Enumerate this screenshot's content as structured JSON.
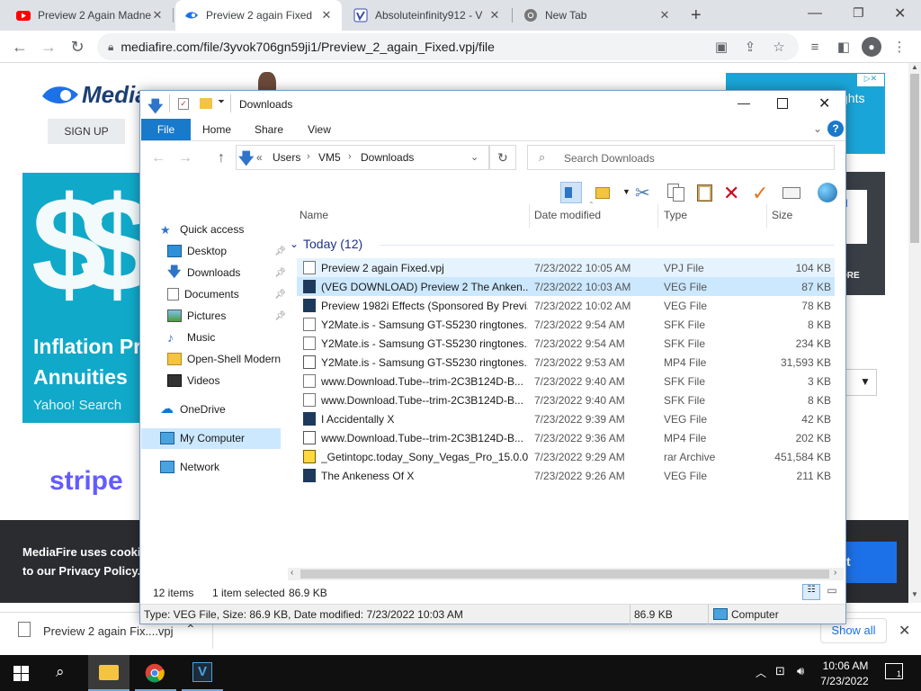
{
  "browser": {
    "tabs": [
      {
        "title": "Preview 2 Again Madne",
        "icon": "youtube-icon",
        "active": false
      },
      {
        "title": "Preview 2 again Fixed",
        "icon": "mediafire-icon",
        "active": true
      },
      {
        "title": "Absoluteinfinity912 - V",
        "icon": "vimeo-icon",
        "active": false
      },
      {
        "title": "New Tab",
        "icon": "chrome-icon",
        "active": false
      }
    ],
    "url": "mediafire.com/file/3yvok706gn59ji1/Preview_2_again_Fixed.vpj/file"
  },
  "webpage": {
    "logo": "MediaFire",
    "signup": "SIGN UP",
    "ad_headline1": "Inflation Pr",
    "ad_headline2": "Annuities",
    "ad_source": "Yahoo! Search",
    "stripe": "stripe",
    "right_ad_text": "ghts",
    "right_ad_text2": "d",
    "right_btn": "ORE",
    "cookie_line1": "MediaFire uses cookie",
    "cookie_line2": "to our Privacy Policy.."
  },
  "downloads_bar": {
    "filename": "Preview 2 again Fix....vpj",
    "show_all": "Show all"
  },
  "explorer": {
    "title": "Downloads",
    "ribbon_tabs": [
      "File",
      "Home",
      "Share",
      "View"
    ],
    "breadcrumb": {
      "root": "«",
      "parts": [
        "Users",
        "VM5",
        "Downloads"
      ]
    },
    "search_placeholder": "Search Downloads",
    "columns": {
      "name": "Name",
      "date": "Date modified",
      "type": "Type",
      "size": "Size"
    },
    "group": "Today (12)",
    "nav": [
      {
        "label": "Quick access",
        "icon": "star-icon",
        "pinned": false
      },
      {
        "label": "Desktop",
        "icon": "desktop-icon",
        "pinned": true
      },
      {
        "label": "Downloads",
        "icon": "download-icon",
        "pinned": true
      },
      {
        "label": "Documents",
        "icon": "documents-icon",
        "pinned": true
      },
      {
        "label": "Pictures",
        "icon": "pictures-icon",
        "pinned": true
      },
      {
        "label": "Music",
        "icon": "music-icon",
        "pinned": false
      },
      {
        "label": "Open-Shell Modern",
        "icon": "folder-icon",
        "pinned": false
      },
      {
        "label": "Videos",
        "icon": "videos-icon",
        "pinned": false
      },
      {
        "label": "OneDrive",
        "icon": "cloud-icon",
        "pinned": false
      },
      {
        "label": "My Computer",
        "icon": "computer-icon",
        "pinned": false
      },
      {
        "label": "Network",
        "icon": "network-icon",
        "pinned": false
      }
    ],
    "files": [
      {
        "name": "Preview 2 again Fixed.vpj",
        "date": "7/23/2022 10:05 AM",
        "type": "VPJ File",
        "size": "104 KB",
        "icon": "doc"
      },
      {
        "name": "(VEG DOWNLOAD) Preview 2 The Anken...",
        "date": "7/23/2022 10:03 AM",
        "type": "VEG File",
        "size": "87 KB",
        "icon": "veg"
      },
      {
        "name": "Preview 1982i Effects (Sponsored By Previ...",
        "date": "7/23/2022 10:02 AM",
        "type": "VEG File",
        "size": "78 KB",
        "icon": "veg"
      },
      {
        "name": "Y2Mate.is - Samsung GT-S5230 ringtones...",
        "date": "7/23/2022 9:54 AM",
        "type": "SFK File",
        "size": "8 KB",
        "icon": "doc"
      },
      {
        "name": "Y2Mate.is - Samsung GT-S5230 ringtones...",
        "date": "7/23/2022 9:54 AM",
        "type": "SFK File",
        "size": "234 KB",
        "icon": "doc"
      },
      {
        "name": "Y2Mate.is - Samsung GT-S5230 ringtones...",
        "date": "7/23/2022 9:53 AM",
        "type": "MP4 File",
        "size": "31,593 KB",
        "icon": "mp4"
      },
      {
        "name": "www.Download.Tube--trim-2C3B124D-B...",
        "date": "7/23/2022 9:40 AM",
        "type": "SFK File",
        "size": "3 KB",
        "icon": "doc"
      },
      {
        "name": "www.Download.Tube--trim-2C3B124D-B...",
        "date": "7/23/2022 9:40 AM",
        "type": "SFK File",
        "size": "8 KB",
        "icon": "doc"
      },
      {
        "name": "I Accidentally X",
        "date": "7/23/2022 9:39 AM",
        "type": "VEG File",
        "size": "42 KB",
        "icon": "veg"
      },
      {
        "name": "www.Download.Tube--trim-2C3B124D-B...",
        "date": "7/23/2022 9:36 AM",
        "type": "MP4 File",
        "size": "202 KB",
        "icon": "mp4"
      },
      {
        "name": "_Getintopc.today_Sony_Vegas_Pro_15.0.0",
        "date": "7/23/2022 9:29 AM",
        "type": "rar Archive",
        "size": "451,584 KB",
        "icon": "rar"
      },
      {
        "name": "The Ankeness Of X",
        "date": "7/23/2022 9:26 AM",
        "type": "VEG File",
        "size": "211 KB",
        "icon": "veg"
      }
    ],
    "status": {
      "count": "12 items",
      "selected": "1 item selected",
      "selected_size": "86.9 KB"
    },
    "infobar": {
      "details": "Type: VEG File, Size: 86.9 KB, Date modified: 7/23/2022 10:03 AM",
      "size": "86.9 KB",
      "location": "Computer"
    }
  },
  "taskbar": {
    "time": "10:06 AM",
    "date": "7/23/2022",
    "notifications": "1"
  }
}
